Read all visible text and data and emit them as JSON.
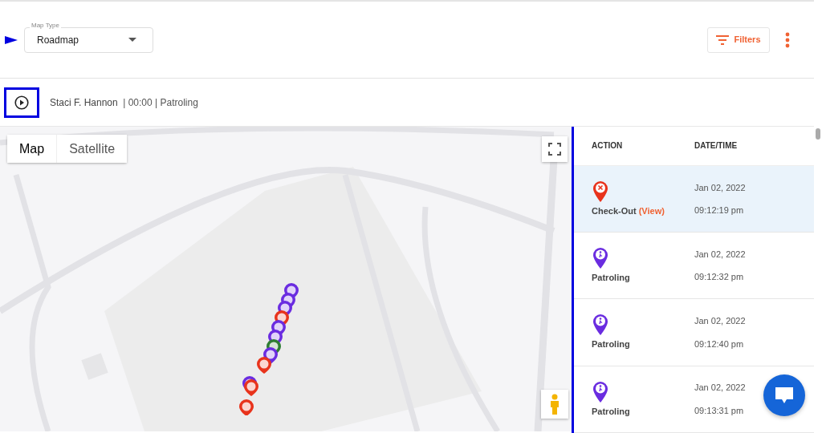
{
  "map_type": {
    "label": "Map Type",
    "value": "Roadmap"
  },
  "filters_button": "Filters",
  "playback": {
    "name": "Staci F. Hannon",
    "info": "| 00:00 | Patroling"
  },
  "map": {
    "kind": "picture",
    "view_buttons": [
      {
        "label": "Map",
        "selected": true
      },
      {
        "label": "Satellite",
        "selected": false
      }
    ]
  },
  "log": {
    "columns": [
      "ACTION",
      "DATE/TIME"
    ],
    "rows": [
      {
        "kind": "check-out",
        "action": "Check-Out",
        "link": "(View)",
        "date": "Jan 02, 2022",
        "time": "09:12:19 pm",
        "selected": true
      },
      {
        "kind": "patrol",
        "action": "Patroling",
        "date": "Jan 02, 2022",
        "time": "09:12:32 pm",
        "selected": false
      },
      {
        "kind": "patrol",
        "action": "Patroling",
        "date": "Jan 02, 2022",
        "time": "09:12:40 pm",
        "selected": false
      },
      {
        "kind": "patrol",
        "action": "Patroling",
        "date": "Jan 02, 2022",
        "time": "09:13:31 pm",
        "selected": false
      }
    ]
  }
}
